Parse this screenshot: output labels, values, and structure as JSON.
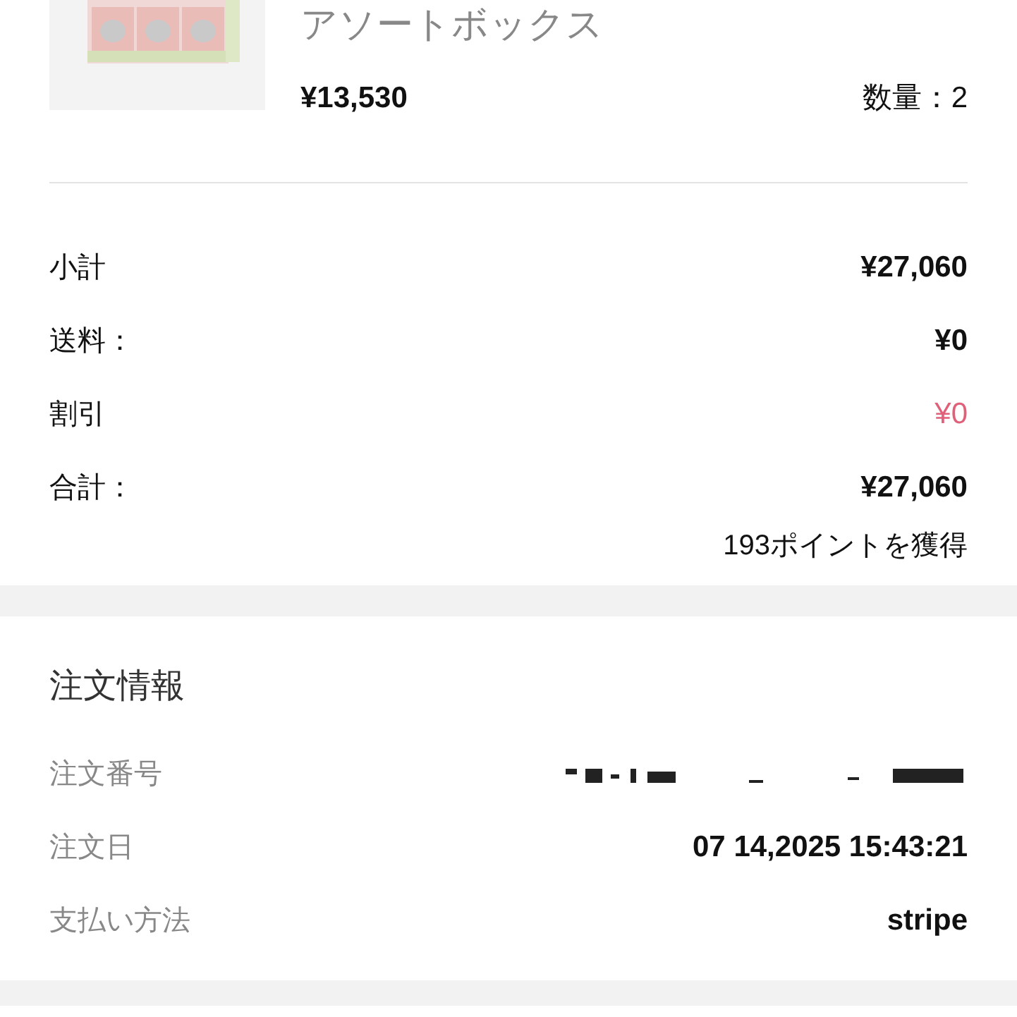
{
  "product": {
    "title": "アソートボックス",
    "price": "¥13,530",
    "quantity": "数量：2"
  },
  "summary": [
    {
      "label": "小計",
      "value": "¥27,060",
      "kind": "normal"
    },
    {
      "label": "送料：",
      "value": "¥0",
      "kind": "normal"
    },
    {
      "label": "割引",
      "value": "¥0",
      "kind": "discount"
    },
    {
      "label": "合計：",
      "value": "¥27,060",
      "kind": "normal"
    }
  ],
  "points": "193ポイントを獲得",
  "order_info": {
    "title": "注文情報",
    "rows": [
      {
        "label": "注文番号",
        "kind": "redacted"
      },
      {
        "label": "注文日",
        "value": "07 14,2025 15:43:21",
        "kind": "text"
      },
      {
        "label": "支払い方法",
        "value": "stripe",
        "kind": "text"
      }
    ]
  }
}
